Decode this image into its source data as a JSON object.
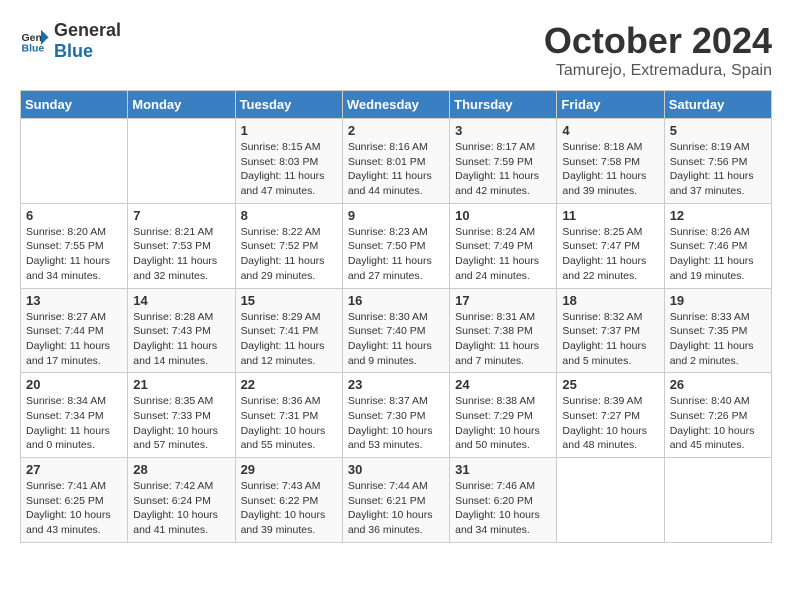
{
  "header": {
    "logo_general": "General",
    "logo_blue": "Blue",
    "month": "October 2024",
    "location": "Tamurejo, Extremadura, Spain"
  },
  "calendar": {
    "weekdays": [
      "Sunday",
      "Monday",
      "Tuesday",
      "Wednesday",
      "Thursday",
      "Friday",
      "Saturday"
    ],
    "weeks": [
      [
        {
          "day": "",
          "info": ""
        },
        {
          "day": "",
          "info": ""
        },
        {
          "day": "1",
          "info": "Sunrise: 8:15 AM\nSunset: 8:03 PM\nDaylight: 11 hours and 47 minutes."
        },
        {
          "day": "2",
          "info": "Sunrise: 8:16 AM\nSunset: 8:01 PM\nDaylight: 11 hours and 44 minutes."
        },
        {
          "day": "3",
          "info": "Sunrise: 8:17 AM\nSunset: 7:59 PM\nDaylight: 11 hours and 42 minutes."
        },
        {
          "day": "4",
          "info": "Sunrise: 8:18 AM\nSunset: 7:58 PM\nDaylight: 11 hours and 39 minutes."
        },
        {
          "day": "5",
          "info": "Sunrise: 8:19 AM\nSunset: 7:56 PM\nDaylight: 11 hours and 37 minutes."
        }
      ],
      [
        {
          "day": "6",
          "info": "Sunrise: 8:20 AM\nSunset: 7:55 PM\nDaylight: 11 hours and 34 minutes."
        },
        {
          "day": "7",
          "info": "Sunrise: 8:21 AM\nSunset: 7:53 PM\nDaylight: 11 hours and 32 minutes."
        },
        {
          "day": "8",
          "info": "Sunrise: 8:22 AM\nSunset: 7:52 PM\nDaylight: 11 hours and 29 minutes."
        },
        {
          "day": "9",
          "info": "Sunrise: 8:23 AM\nSunset: 7:50 PM\nDaylight: 11 hours and 27 minutes."
        },
        {
          "day": "10",
          "info": "Sunrise: 8:24 AM\nSunset: 7:49 PM\nDaylight: 11 hours and 24 minutes."
        },
        {
          "day": "11",
          "info": "Sunrise: 8:25 AM\nSunset: 7:47 PM\nDaylight: 11 hours and 22 minutes."
        },
        {
          "day": "12",
          "info": "Sunrise: 8:26 AM\nSunset: 7:46 PM\nDaylight: 11 hours and 19 minutes."
        }
      ],
      [
        {
          "day": "13",
          "info": "Sunrise: 8:27 AM\nSunset: 7:44 PM\nDaylight: 11 hours and 17 minutes."
        },
        {
          "day": "14",
          "info": "Sunrise: 8:28 AM\nSunset: 7:43 PM\nDaylight: 11 hours and 14 minutes."
        },
        {
          "day": "15",
          "info": "Sunrise: 8:29 AM\nSunset: 7:41 PM\nDaylight: 11 hours and 12 minutes."
        },
        {
          "day": "16",
          "info": "Sunrise: 8:30 AM\nSunset: 7:40 PM\nDaylight: 11 hours and 9 minutes."
        },
        {
          "day": "17",
          "info": "Sunrise: 8:31 AM\nSunset: 7:38 PM\nDaylight: 11 hours and 7 minutes."
        },
        {
          "day": "18",
          "info": "Sunrise: 8:32 AM\nSunset: 7:37 PM\nDaylight: 11 hours and 5 minutes."
        },
        {
          "day": "19",
          "info": "Sunrise: 8:33 AM\nSunset: 7:35 PM\nDaylight: 11 hours and 2 minutes."
        }
      ],
      [
        {
          "day": "20",
          "info": "Sunrise: 8:34 AM\nSunset: 7:34 PM\nDaylight: 11 hours and 0 minutes."
        },
        {
          "day": "21",
          "info": "Sunrise: 8:35 AM\nSunset: 7:33 PM\nDaylight: 10 hours and 57 minutes."
        },
        {
          "day": "22",
          "info": "Sunrise: 8:36 AM\nSunset: 7:31 PM\nDaylight: 10 hours and 55 minutes."
        },
        {
          "day": "23",
          "info": "Sunrise: 8:37 AM\nSunset: 7:30 PM\nDaylight: 10 hours and 53 minutes."
        },
        {
          "day": "24",
          "info": "Sunrise: 8:38 AM\nSunset: 7:29 PM\nDaylight: 10 hours and 50 minutes."
        },
        {
          "day": "25",
          "info": "Sunrise: 8:39 AM\nSunset: 7:27 PM\nDaylight: 10 hours and 48 minutes."
        },
        {
          "day": "26",
          "info": "Sunrise: 8:40 AM\nSunset: 7:26 PM\nDaylight: 10 hours and 45 minutes."
        }
      ],
      [
        {
          "day": "27",
          "info": "Sunrise: 7:41 AM\nSunset: 6:25 PM\nDaylight: 10 hours and 43 minutes."
        },
        {
          "day": "28",
          "info": "Sunrise: 7:42 AM\nSunset: 6:24 PM\nDaylight: 10 hours and 41 minutes."
        },
        {
          "day": "29",
          "info": "Sunrise: 7:43 AM\nSunset: 6:22 PM\nDaylight: 10 hours and 39 minutes."
        },
        {
          "day": "30",
          "info": "Sunrise: 7:44 AM\nSunset: 6:21 PM\nDaylight: 10 hours and 36 minutes."
        },
        {
          "day": "31",
          "info": "Sunrise: 7:46 AM\nSunset: 6:20 PM\nDaylight: 10 hours and 34 minutes."
        },
        {
          "day": "",
          "info": ""
        },
        {
          "day": "",
          "info": ""
        }
      ]
    ]
  }
}
